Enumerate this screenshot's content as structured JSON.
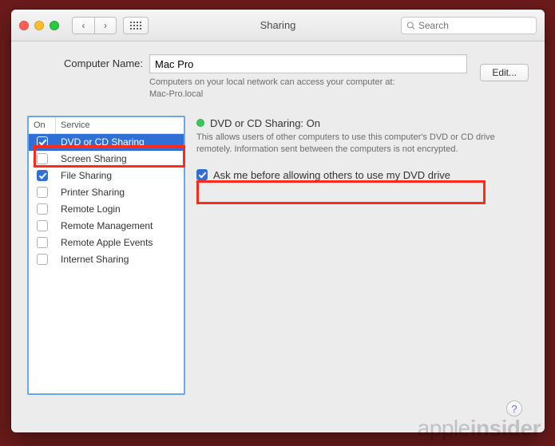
{
  "window": {
    "title": "Sharing"
  },
  "search": {
    "placeholder": "Search"
  },
  "computerName": {
    "label": "Computer Name:",
    "value": "Mac Pro",
    "subtext": "Computers on your local network can access your computer at:\nMac-Pro.local",
    "editLabel": "Edit..."
  },
  "services": {
    "headers": {
      "on": "On",
      "service": "Service"
    },
    "items": [
      {
        "label": "DVD or CD Sharing",
        "checked": true,
        "selected": true
      },
      {
        "label": "Screen Sharing",
        "checked": false,
        "selected": false
      },
      {
        "label": "File Sharing",
        "checked": true,
        "selected": false
      },
      {
        "label": "Printer Sharing",
        "checked": false,
        "selected": false
      },
      {
        "label": "Remote Login",
        "checked": false,
        "selected": false
      },
      {
        "label": "Remote Management",
        "checked": false,
        "selected": false
      },
      {
        "label": "Remote Apple Events",
        "checked": false,
        "selected": false
      },
      {
        "label": "Internet Sharing",
        "checked": false,
        "selected": false
      }
    ]
  },
  "detail": {
    "statusText": "DVD or CD Sharing: On",
    "statusColor": "#38c759",
    "description": "This allows users of other computers to use this computer's DVD or CD drive remotely. Information sent between the computers is not encrypted.",
    "askChecked": true,
    "askLabel": "Ask me before allowing others to use my DVD drive"
  },
  "help": {
    "label": "?"
  },
  "watermark": "appleinsider"
}
